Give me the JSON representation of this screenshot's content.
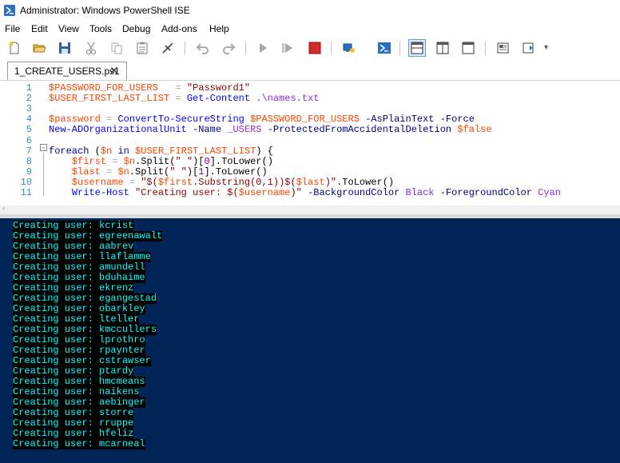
{
  "window": {
    "title": "Administrator: Windows PowerShell ISE"
  },
  "menu": [
    "File",
    "Edit",
    "View",
    "Tools",
    "Debug",
    "Add-ons",
    "Help"
  ],
  "toolbar": {
    "icons": [
      "new-file-icon",
      "open-file-icon",
      "save-icon",
      "cut-icon",
      "copy-icon",
      "paste-icon",
      "clear-icon",
      "undo-icon",
      "redo-icon",
      "run-script-icon",
      "run-selection-icon",
      "stop-icon",
      "remote-powershell-icon",
      "powershell-console-icon",
      "show-script-pane-top-icon",
      "show-script-pane-right-icon",
      "show-script-pane-maximized-icon",
      "show-command-window-icon",
      "show-command-addon-icon"
    ]
  },
  "tab": {
    "label": "1_CREATE_USERS.ps1",
    "close": "✕"
  },
  "editor": {
    "line_numbers": [
      "1",
      "2",
      "3",
      "4",
      "5",
      "6",
      "7",
      "8",
      "9",
      "10",
      "11"
    ],
    "lines": [
      {
        "n": "1",
        "tokens": [
          [
            "v",
            "$PASSWORD_FOR_USERS"
          ],
          [
            "pl",
            "   "
          ],
          [
            "o",
            "="
          ],
          [
            "pl",
            " "
          ],
          [
            "s",
            "\"Password1\""
          ]
        ]
      },
      {
        "n": "2",
        "tokens": [
          [
            "v",
            "$USER_FIRST_LAST_LIST"
          ],
          [
            "pl",
            " "
          ],
          [
            "o",
            "="
          ],
          [
            "pl",
            " "
          ],
          [
            "c",
            "Get-Content"
          ],
          [
            "pl",
            " "
          ],
          [
            "m",
            ".\\names.txt"
          ]
        ]
      },
      {
        "n": "3",
        "tokens": []
      },
      {
        "n": "4",
        "tokens": [
          [
            "v",
            "$password"
          ],
          [
            "pl",
            " "
          ],
          [
            "o",
            "="
          ],
          [
            "pl",
            " "
          ],
          [
            "c",
            "ConvertTo-SecureString"
          ],
          [
            "pl",
            " "
          ],
          [
            "v",
            "$PASSWORD_FOR_USERS"
          ],
          [
            "pl",
            " "
          ],
          [
            "p",
            "-AsPlainText"
          ],
          [
            "pl",
            " "
          ],
          [
            "p",
            "-Force"
          ]
        ]
      },
      {
        "n": "5",
        "tokens": [
          [
            "c",
            "New-ADOrganizationalUnit"
          ],
          [
            "pl",
            " "
          ],
          [
            "p",
            "-Name"
          ],
          [
            "pl",
            " "
          ],
          [
            "m",
            "_USERS"
          ],
          [
            "pl",
            " "
          ],
          [
            "p",
            "-ProtectedFromAccidentalDeletion"
          ],
          [
            "pl",
            " "
          ],
          [
            "v",
            "$false"
          ]
        ]
      },
      {
        "n": "6",
        "tokens": []
      },
      {
        "n": "7",
        "tokens": [
          [
            "k",
            "foreach"
          ],
          [
            "pl",
            " ("
          ],
          [
            "v",
            "$n"
          ],
          [
            "pl",
            " "
          ],
          [
            "k",
            "in"
          ],
          [
            "pl",
            " "
          ],
          [
            "v",
            "$USER_FIRST_LAST_LIST"
          ],
          [
            "pl",
            ") {"
          ]
        ]
      },
      {
        "n": "8",
        "tokens": [
          [
            "pl",
            "    "
          ],
          [
            "v",
            "$first"
          ],
          [
            "pl",
            " "
          ],
          [
            "o",
            "="
          ],
          [
            "pl",
            " "
          ],
          [
            "v",
            "$n"
          ],
          [
            "pl",
            "."
          ],
          [
            "pl",
            "Split("
          ],
          [
            "s",
            "\" \""
          ],
          [
            "pl",
            ")["
          ],
          [
            "n",
            "0"
          ],
          [
            "pl",
            "].ToLower()"
          ]
        ]
      },
      {
        "n": "9",
        "tokens": [
          [
            "pl",
            "    "
          ],
          [
            "v",
            "$last"
          ],
          [
            "pl",
            " "
          ],
          [
            "o",
            "="
          ],
          [
            "pl",
            " "
          ],
          [
            "v",
            "$n"
          ],
          [
            "pl",
            "."
          ],
          [
            "pl",
            "Split("
          ],
          [
            "s",
            "\" \""
          ],
          [
            "pl",
            ")["
          ],
          [
            "n",
            "1"
          ],
          [
            "pl",
            "].ToLower()"
          ]
        ]
      },
      {
        "n": "10",
        "tokens": [
          [
            "pl",
            "    "
          ],
          [
            "v",
            "$username"
          ],
          [
            "pl",
            " "
          ],
          [
            "o",
            "="
          ],
          [
            "pl",
            " "
          ],
          [
            "s",
            "\"$("
          ],
          [
            "v",
            "$first"
          ],
          [
            "s",
            ".Substring(0,1))$("
          ],
          [
            "v",
            "$last"
          ],
          [
            "s",
            ")\""
          ],
          [
            "pl",
            ".ToLower()"
          ]
        ]
      },
      {
        "n": "11",
        "tokens": [
          [
            "pl",
            "    "
          ],
          [
            "c",
            "Write-Host"
          ],
          [
            "pl",
            " "
          ],
          [
            "s",
            "\"Creating user: $("
          ],
          [
            "v",
            "$username"
          ],
          [
            "s",
            ")\""
          ],
          [
            "pl",
            " "
          ],
          [
            "p",
            "-BackgroundColor"
          ],
          [
            "pl",
            " "
          ],
          [
            "m",
            "Black"
          ],
          [
            "pl",
            " "
          ],
          [
            "p",
            "-ForegroundColor"
          ],
          [
            "pl",
            " "
          ],
          [
            "m",
            "Cyan"
          ]
        ]
      }
    ]
  },
  "console": {
    "lines": [
      "Creating user: kcrist",
      "Creating user: egreenawalt",
      "Creating user: aabrev",
      "Creating user: llaflamme",
      "Creating user: amundell",
      "Creating user: bduhaime",
      "Creating user: ekrenz",
      "Creating user: egangestad",
      "Creating user: obarkley",
      "Creating user: lteller",
      "Creating user: kmccullers",
      "Creating user: lprothro",
      "Creating user: rpaynter",
      "Creating user: cstrawser",
      "Creating user: ptardy",
      "Creating user: hmcmeans",
      "Creating user: naikens",
      "Creating user: aebinger",
      "Creating user: storre",
      "Creating user: rruppe",
      "Creating user: hfeliz",
      "Creating user: mcarneal"
    ]
  },
  "colors": {
    "console_bg": "#012456",
    "console_fg": "#00ffff",
    "console_line_bg": "#000000",
    "line_number": "#2b91af"
  }
}
